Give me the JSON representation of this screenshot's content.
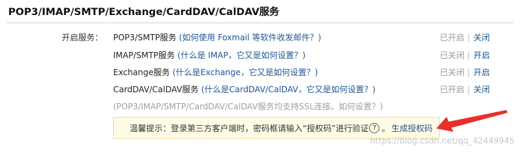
{
  "title": "POP3/IMAP/SMTP/Exchange/CardDAV/CalDAV服务",
  "row_label": "开启服务：",
  "services": [
    {
      "name": "POP3/SMTP服务",
      "help": "(如何使用 Foxmail 等软件收发邮件？)",
      "state": "已开启",
      "separator": "|",
      "action": "关闭"
    },
    {
      "name": "IMAP/SMTP服务",
      "help": "(什么是 IMAP，它又是如何设置？)",
      "state": "已关闭",
      "separator": "|",
      "action": "开启"
    },
    {
      "name": "Exchange服务",
      "help": "(什么是Exchange，它又是如何设置？)",
      "state": "已关闭",
      "separator": "|",
      "action": "开启"
    },
    {
      "name": "CardDAV/CalDAV服务",
      "help": "(什么是CardDAV/CalDAV，它又是如何设置？)",
      "state": "已开启",
      "separator": "|",
      "action": "关闭"
    }
  ],
  "ssl_note": {
    "text": "(POP3/IMAP/SMTP/CardDAV/CalDAV服务均支持SSL连接。",
    "help": "如何设置？",
    "close": ")"
  },
  "tip": {
    "text": "温馨提示：登录第三方客户端时，密码框请输入“授权码”进行验证",
    "qmark": "?",
    "period": "。",
    "generate": "生成授权码"
  },
  "watermark": "https://blog.csdn.net/qq_42449945",
  "colors": {
    "link": "#1e5494",
    "arrow": "#e8302a",
    "tip_bg": "#fffbe5",
    "tip_border": "#f1dc9e"
  },
  "icons": {
    "arrow": "red-arrow-icon",
    "help": "question-circle-icon"
  }
}
